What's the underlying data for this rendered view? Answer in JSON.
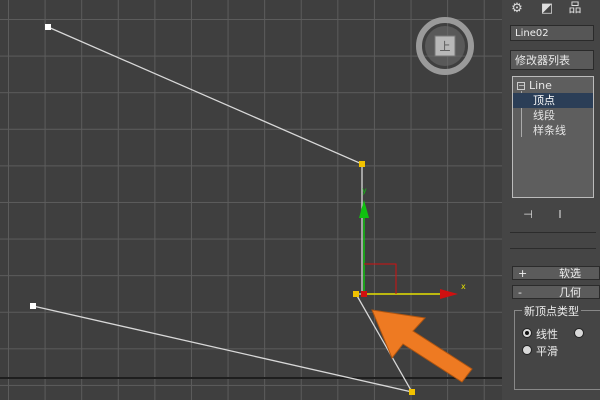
{
  "viewport": {
    "viewcube_face": "上"
  },
  "panel": {
    "tabs": [
      {
        "icon": "gear-icon",
        "glyph": "⚙"
      },
      {
        "icon": "modify-icon",
        "glyph": "◩"
      },
      {
        "icon": "hierarchy-icon",
        "glyph": "品"
      }
    ],
    "object_name": "Line02",
    "modifier_list": "修改器列表",
    "stack": {
      "root": "Line",
      "items": [
        "顶点",
        "线段",
        "样条线"
      ],
      "selected_index": 0
    },
    "tools": [
      {
        "icon": "pin-stack-icon",
        "glyph": "⊣"
      },
      {
        "icon": "show-end-result-icon",
        "glyph": "Ⅰ"
      }
    ],
    "rollouts": [
      {
        "sign": "+",
        "title": "软选"
      },
      {
        "sign": "-",
        "title": "几何"
      }
    ],
    "vertex_type": {
      "title": "新顶点类型",
      "options": [
        {
          "label": "线性",
          "checked": true
        },
        {
          "label": "平滑",
          "checked": false
        }
      ]
    }
  },
  "colors": {
    "grid": "#5c5c5c",
    "viewport_bg": "#3f3f3f",
    "spline": "#d8d8d8",
    "vertex": "#f2c200",
    "annotation_arrow": "#ee7a22",
    "gizmo_x": "#d01010",
    "gizmo_y": "#10c010",
    "selection_highlight": "#2b3e57"
  }
}
